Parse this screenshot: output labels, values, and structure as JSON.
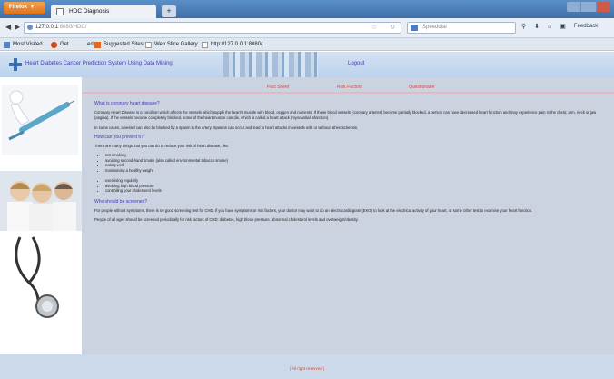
{
  "browser": {
    "menu_button": "Firefox",
    "tab_title": "HDC Diagnosis",
    "new_tab": "+",
    "url_host": "127.0.0.1",
    "url_rest": ":8080/HDC/",
    "search_placeholder": "Speeddial",
    "feedback": "Feedback",
    "bookmarks": [
      "Most Visited",
      "Get",
      "ed",
      "Suggested Sites",
      "Web Slice Gallery",
      "http://127.0.0.1:8080/..."
    ]
  },
  "header": {
    "site_title": "Heart Diabetes Cancer Prediction System Using Data Mining",
    "logout": "Logout"
  },
  "nav": {
    "tabs": [
      "Fact Sheet",
      "Risk Factors",
      "Questionaire"
    ]
  },
  "content": {
    "q1": "What is coronary heart disease?",
    "p1": "Coronary Heart Disease is a condition which affects the vessels which supply the heart's muscle with blood, oxygen and nutrients. If these blood vessels (coronary arteries) become partially blocked, a person can have decreased heart function and may experience pain in the chest, arm, neck or jaw (angina). If the vessels become completely blocked, some of the heart muscle can die, which is called a heart attack (myocardial infarction).",
    "p2": "In some cases, a vessel can also be blocked by a spasm in the artery. Spasms can occur and lead to heart attacks in vessels with or without atherosclerosis.",
    "q2": "How can you prevent it?",
    "p3": "There are many things that you can do to reduce your risk of heart disease, like:",
    "list": [
      "not smoking",
      "avoiding second-hand smoke (also called environmental tobacco smoke)",
      "eating well",
      "maintaining a healthy weight",
      "",
      "exercising regularly",
      "avoiding high blood pressure",
      "controlling your cholesterol levels"
    ],
    "q3": "Who should be screened?",
    "p4": "For people without symptoms, there is no good screening test for CHD. If you have symptoms or risk factors, your doctor may want to do an electrocardiogram (EKG) to look at the electrical activity of your heart, or some other test to examine your heart function.",
    "p5": "People of all ages should be screened periodically for risk factors of CHD: diabetes, high blood pressure, abnormal cholesterol levels and overweight/obesity."
  },
  "footer": {
    "copyright": "| All right reserved |"
  }
}
